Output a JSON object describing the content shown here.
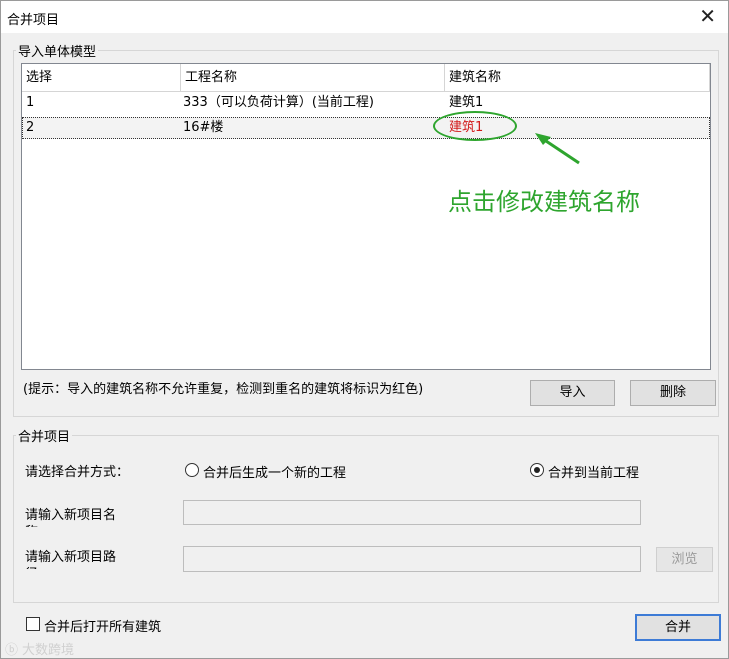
{
  "window": {
    "title": "合并项目",
    "close_glyph": "✕"
  },
  "import_group": {
    "legend": "导入单体模型",
    "columns": [
      "选择",
      "工程名称",
      "建筑名称"
    ],
    "rows": [
      {
        "select": "1",
        "project": "333（可以负荷计算）(当前工程)",
        "building": "建筑1"
      },
      {
        "select": "2",
        "project": "16#楼",
        "building": "建筑1"
      }
    ],
    "hint": "(提示：导入的建筑名称不允许重复，检测到重名的建筑将标识为红色)",
    "import_button": "导入",
    "delete_button": "删除"
  },
  "annotation": {
    "text": "点击修改建筑名称",
    "color": "#2ea52e"
  },
  "merge_group": {
    "legend": "合并项目",
    "method_label": "请选择合并方式：",
    "option_new": "合并后生成一个新的工程",
    "option_current": "合并到当前工程",
    "selected_option": "option_current",
    "name_label": "请输入新项目名称：",
    "path_label": "请输入新项目路径：",
    "name_value": "",
    "path_value": "",
    "browse_button": "浏览"
  },
  "open_all_checkbox": {
    "label": "合并后打开所有建筑",
    "checked": false
  },
  "merge_button": "合并",
  "watermark": "大数跨境",
  "colors": {
    "duplicate_red": "#d21a1a",
    "focus_blue": "#3d7bd6"
  }
}
